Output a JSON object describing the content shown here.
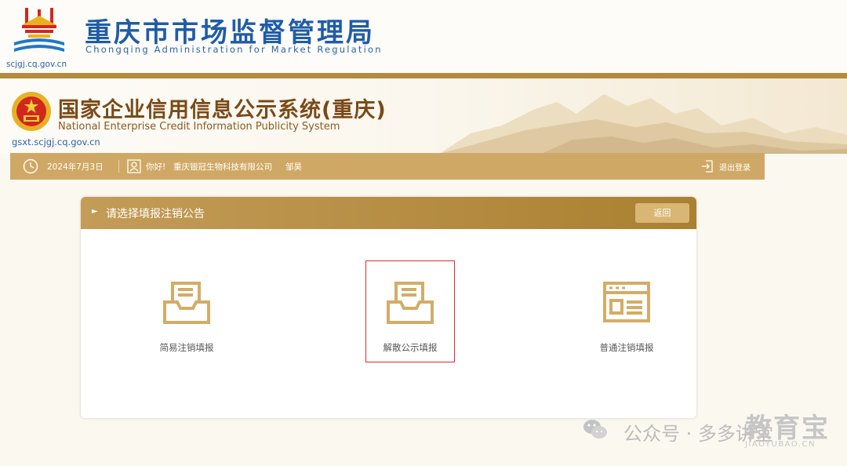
{
  "header": {
    "title": "重庆市市场监督管理局",
    "subtitle": "Chongqing Administration for Market Regulation",
    "site": "scjgj.cq.gov.cn"
  },
  "banner": {
    "title": "国家企业信用信息公示系统(重庆)",
    "subtitle": "National Enterprise Credit Information Publicity System",
    "site": "gsxt.scjgj.cq.gov.cn"
  },
  "status_bar": {
    "date": "2024年7月3日",
    "greeting": "你好!",
    "company": "重庆银冠生物科技有限公司",
    "person": "邹昊",
    "logout_label": "退出登录"
  },
  "panel": {
    "title": "请选择填报注销公告",
    "back_label": "返回",
    "options": [
      {
        "label": "简易注销填报",
        "icon": "inbox-document-icon",
        "selected": false
      },
      {
        "label": "解散公示填报",
        "icon": "inbox-document-icon",
        "selected": true
      },
      {
        "label": "普通注销填报",
        "icon": "form-window-icon",
        "selected": false
      }
    ]
  },
  "watermark": {
    "text": "公众号 · 多多讲堂",
    "logo": "教育宝",
    "domain": "JIAOYUBAO.CN"
  },
  "colors": {
    "primary_blue": "#1f5ca8",
    "gold": "#c39c57",
    "gold_dark": "#aa8031",
    "status_bar": "#d0a865",
    "selected_outline": "#e0292d"
  }
}
